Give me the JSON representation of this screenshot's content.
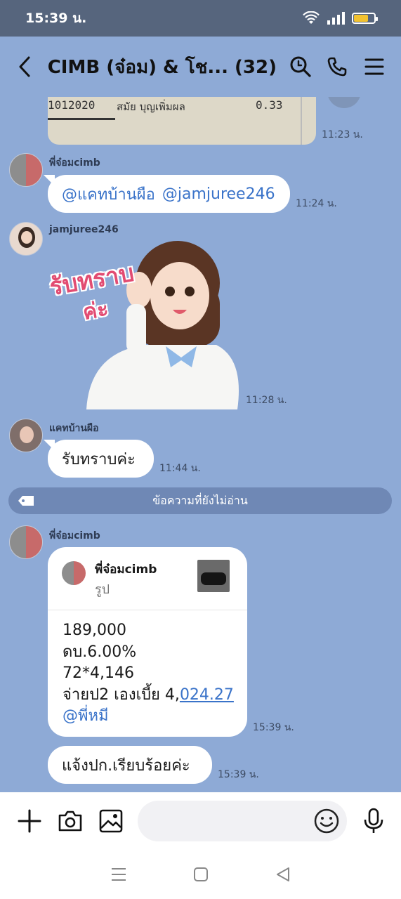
{
  "status_bar": {
    "time": "15:39 น."
  },
  "header": {
    "title": "CIMB (จ๋อม) & โช... (32)"
  },
  "messages": {
    "img_snippet": {
      "col1": "1012020",
      "col2": "สมัย บุญเพิ่มผล",
      "col3": "0.33",
      "time": "11:23 น."
    },
    "m1": {
      "sender": "พี่จ๋อมcimb",
      "text_a": "@แคทบ้านผือ",
      "text_b": "@jamjuree246",
      "time": "11:24 น."
    },
    "m2": {
      "sender": "jamjuree246",
      "sticker_text_1": "รับทราบ",
      "sticker_text_2": "ค่ะ",
      "time": "11:28 น."
    },
    "m3": {
      "sender": "แคทบ้านผือ",
      "text": "รับทราบค่ะ",
      "time": "11:44 น."
    },
    "unread": "ข้อความที่ยังไม่อ่าน",
    "m4": {
      "sender": "พี่จ๋อมcimb",
      "quote_name": "พี่จ๋อมcimb",
      "quote_sub": "รูป",
      "line1": "189,000",
      "line2": "ดบ.6.00%",
      "line3": "72*4,146",
      "line4_a": "จ่ายป2 เองเบี้ย 4,",
      "line4_b": "024.27",
      "line5": "@พี่หมี",
      "time": "15:39 น."
    },
    "m5": {
      "text": "แจ้งปก.เรียบร้อยค่ะ",
      "time": "15:39 น."
    }
  },
  "input": {
    "placeholder": ""
  }
}
